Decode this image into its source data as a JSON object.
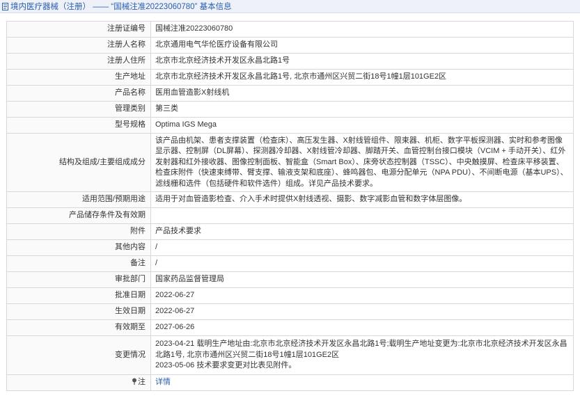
{
  "header": {
    "title": "境内医疗器械（注册） —— “国械注准20223060780” 基本信息",
    "icon": "document-icon",
    "accent_color": "#2a5db0"
  },
  "rows": [
    {
      "label": "注册证编号",
      "value": "国械注准20223060780"
    },
    {
      "label": "注册人名称",
      "value": "北京通用电气华伦医疗设备有限公司"
    },
    {
      "label": "注册人住所",
      "value": "北京市北京经济技术开发区永昌北路1号"
    },
    {
      "label": "生产地址",
      "value": "北京市北京经济技术开发区永昌北路1号, 北京市通州区兴贸二街18号1幢1层101GE2区"
    },
    {
      "label": "产品名称",
      "value": "医用血管造影X射线机"
    },
    {
      "label": "管理类别",
      "value": "第三类"
    },
    {
      "label": "型号规格",
      "value": "Optima IGS Mega"
    },
    {
      "label": "结构及组成/主要组成成分",
      "value": "该产品由机架、患者支撑装置（检查床）、高压发生器、X射线管组件、限束器、机柜、数字平板探测器、实时和参考图像显示器、控制屏（DL屏幕）、探测器冷却器、X射线管冷却器、脚踏开关、血管控制台接口模块（VCIM + 手动开关）、红外发射器和红外接收器、图像控制面板、智能盒（Smart Box）、床旁状态控制器（TSSC）、中央触摸屏、检查床平移装置、检查床附件（快速束缚带、臂支撑、输液支架和底座）、蜂鸣器包、电源分配单元（NPA PDU）、不间断电源（基本UPS）、滤线栅和选件（包括硬件和软件选件）组成。详见产品技术要求。"
    },
    {
      "label": "适用范围/预期用途",
      "value": "适用于对血管造影检查、介入手术时提供X射线透视、摄影、数字减影血管和数字体层图像。"
    },
    {
      "label": "产品储存条件及有效期",
      "value": ""
    },
    {
      "label": "附件",
      "value": "产品技术要求"
    },
    {
      "label": "其他内容",
      "value": "/"
    },
    {
      "label": "备注",
      "value": "/"
    },
    {
      "label": "审批部门",
      "value": "国家药品监督管理局"
    },
    {
      "label": "批准日期",
      "value": "2022-06-27"
    },
    {
      "label": "生效日期",
      "value": "2022-06-27"
    },
    {
      "label": "有效期至",
      "value": "2027-06-26"
    }
  ],
  "change_row": {
    "label": "变更情况",
    "lines": [
      "2023-04-21 载明生产地址由:北京市北京经济技术开发区永昌北路1号;载明生产地址变更为:北京市北京经济技术开发区永昌北路1号, 北京市通州区兴贸二街18号1幢1层101GE2区",
      "2023-05-06 技术要求变更对比表见附件。"
    ]
  },
  "detail_row": {
    "label": "注",
    "icon": "pin-icon",
    "link_text": "详情"
  }
}
